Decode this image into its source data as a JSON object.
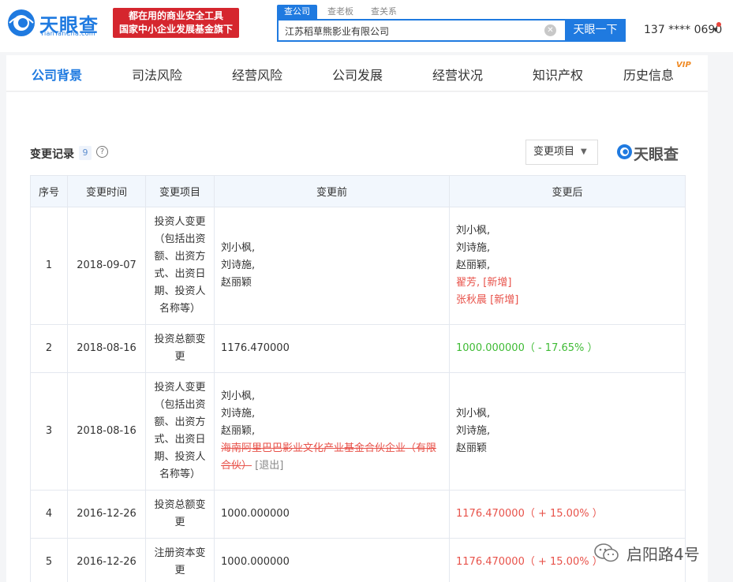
{
  "header": {
    "logo_text": "天眼查",
    "logo_sub": "TianYanCha.com",
    "banner_line1": "都在用的商业安全工具",
    "banner_line2": "国家中小企业发展基金旗下",
    "search_tabs": [
      "查公司",
      "查老板",
      "查关系"
    ],
    "search_value": "江苏稻草熊影业有限公司",
    "search_button": "天眼一下",
    "user_phone": "137 **** 0690"
  },
  "nav": {
    "items": [
      "公司背景",
      "司法风险",
      "经营风险",
      "公司发展",
      "经营状况",
      "知识产权",
      "历史信息"
    ],
    "active": "公司背景",
    "vip": "VIP"
  },
  "section": {
    "title": "变更记录",
    "count": "9",
    "filter_label": "变更项目",
    "watermark": "天眼查"
  },
  "table": {
    "headers": [
      "序号",
      "变更时间",
      "变更项目",
      "变更前",
      "变更后"
    ],
    "rows": [
      {
        "index": "1",
        "date": "2018-09-07",
        "item": "投资人变更（包括出资额、出资方式、出资日期、投资人名称等）",
        "before": [
          "刘小枫,",
          "刘诗施,",
          "赵丽颖"
        ],
        "after": [
          "刘小枫,",
          "刘诗施,",
          "赵丽颖,"
        ],
        "after_added": [
          "翟芳, [新增]",
          "张秋晨 [新增]"
        ]
      },
      {
        "index": "2",
        "date": "2018-08-16",
        "item": "投资总额变更",
        "before": [
          "1176.470000"
        ],
        "after_change": "1000.000000（ - 17.65% ）",
        "after_direction": "down"
      },
      {
        "index": "3",
        "date": "2018-08-16",
        "item": "投资人变更（包括出资额、出资方式、出资日期、投资人名称等）",
        "before": [
          "刘小枫,",
          "刘诗施,",
          "赵丽颖,"
        ],
        "before_removed": "海南阿里巴巴影业文化产业基金合伙企业（有限合伙）",
        "before_removed_tag": "[退出]",
        "after": [
          "刘小枫,",
          "刘诗施,",
          "赵丽颖"
        ]
      },
      {
        "index": "4",
        "date": "2016-12-26",
        "item": "投资总额变更",
        "before": [
          "1000.000000"
        ],
        "after_change": "1176.470000（ + 15.00% ）",
        "after_direction": "up"
      },
      {
        "index": "5",
        "date": "2016-12-26",
        "item": "注册资本变更",
        "before": [
          "1000.000000"
        ],
        "after_change": "1176.470000（ + 15.00% ）",
        "after_direction": "up"
      }
    ]
  },
  "watermark": {
    "text": "启阳路4号"
  },
  "colors": {
    "brand": "#1f7ae0",
    "banner": "#d5262e",
    "added": "#e8524a",
    "decrease": "#3fbb35"
  }
}
